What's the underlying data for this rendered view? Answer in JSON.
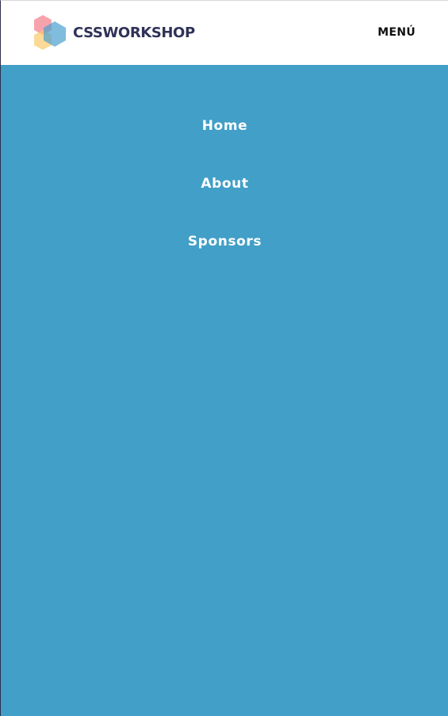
{
  "header": {
    "logo_text": "CSSWORKSHOP",
    "menu_label": "MENÚ"
  },
  "nav": {
    "items": [
      {
        "label": "Home"
      },
      {
        "label": "About"
      },
      {
        "label": "Sponsors"
      }
    ]
  },
  "colors": {
    "panel_background": "#429fc7",
    "logo_text": "#2f3258",
    "logo_pink": "#f47c8a",
    "logo_blue": "#4a9fd0",
    "logo_yellow": "#fbc96a",
    "nav_text": "#ffffff"
  },
  "icons": {
    "logo_mark": "hexagon-cube-icon"
  }
}
